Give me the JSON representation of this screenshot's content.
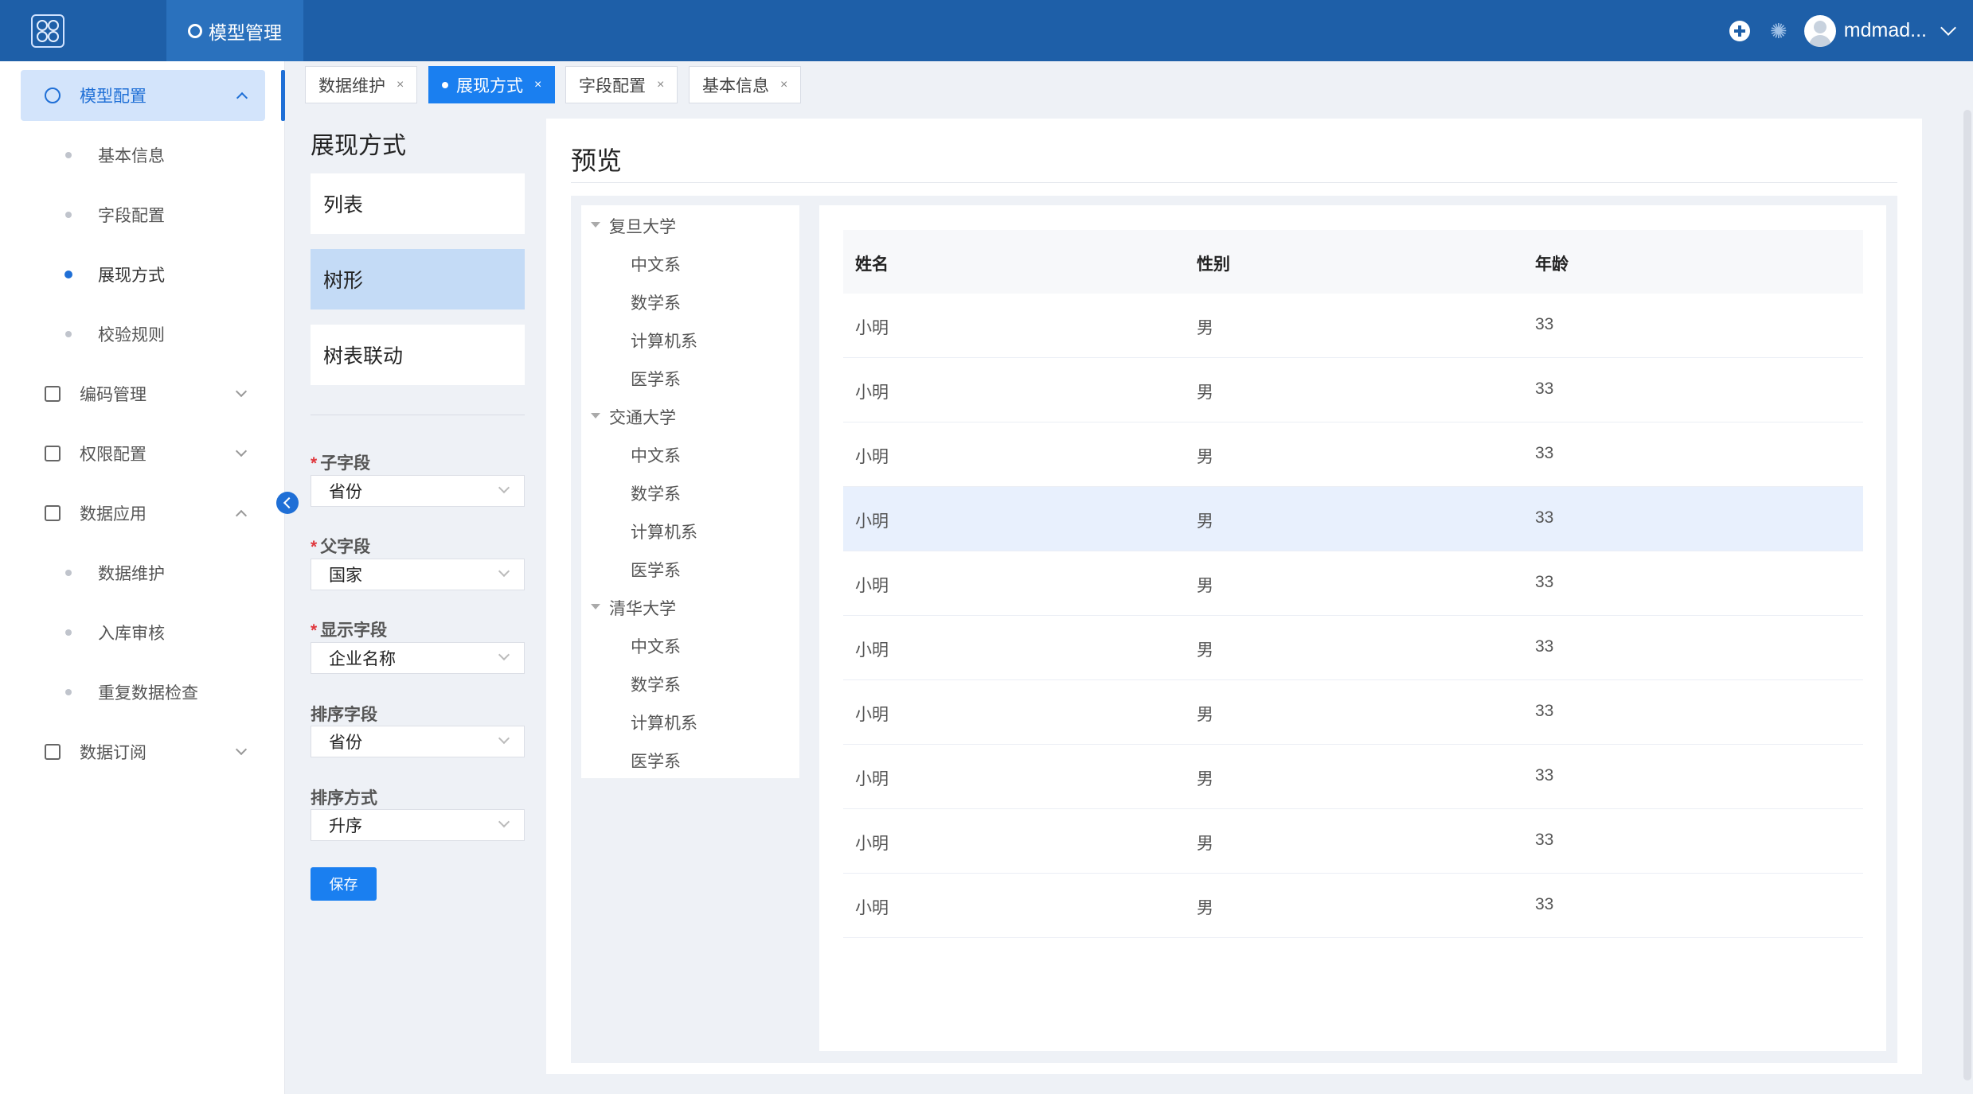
{
  "topbar": {
    "nav_item": "模型管理",
    "user_name": "mdmad...",
    "icons": [
      "logo-icon",
      "gear-icon",
      "plus-circle-icon",
      "ai-assistant-icon",
      "avatar",
      "chevron-down-icon"
    ]
  },
  "sidebar": {
    "model_config": "模型配置",
    "sub_basic_info": "基本信息",
    "sub_field_config": "字段配置",
    "sub_display_mode": "展现方式",
    "sub_validation_rules": "校验规则",
    "code_management": "编码管理",
    "permission_config": "权限配置",
    "data_application": "数据应用",
    "sub_data_maintenance": "数据维护",
    "sub_storage_review": "入库审核",
    "sub_duplicate_check": "重复数据检查",
    "data_subscription": "数据订阅"
  },
  "tabs": [
    {
      "label": "数据维护",
      "close": "×"
    },
    {
      "label": "展现方式",
      "close": "×"
    },
    {
      "label": "字段配置",
      "close": "×"
    },
    {
      "label": "基本信息",
      "close": "×"
    }
  ],
  "config": {
    "title": "展现方式",
    "modes": [
      "列表",
      "树形",
      "树表联动"
    ],
    "selected_mode": "树形",
    "fields": {
      "child_field": {
        "label": "子字段",
        "value": "省份"
      },
      "parent_field": {
        "label": "父字段",
        "value": "国家"
      },
      "display_field": {
        "label": "显示字段",
        "value": "企业名称"
      },
      "sort_field": {
        "label": "排序字段",
        "value": "省份"
      },
      "sort_order": {
        "label": "排序方式",
        "value": "升序"
      }
    },
    "required_mark": "*",
    "save_label": "保存"
  },
  "preview": {
    "title": "预览",
    "tree": [
      {
        "label": "复旦大学",
        "children": [
          "中文系",
          "数学系",
          "计算机系",
          "医学系"
        ]
      },
      {
        "label": "交通大学",
        "children": [
          "中文系",
          "数学系",
          "计算机系",
          "医学系"
        ]
      },
      {
        "label": "清华大学",
        "children": [
          "中文系",
          "数学系",
          "计算机系",
          "医学系"
        ]
      }
    ],
    "table": {
      "columns": [
        "姓名",
        "性别",
        "年龄"
      ],
      "rows": [
        [
          "小明",
          "男",
          "33"
        ],
        [
          "小明",
          "男",
          "33"
        ],
        [
          "小明",
          "男",
          "33"
        ],
        [
          "小明",
          "男",
          "33"
        ],
        [
          "小明",
          "男",
          "33"
        ],
        [
          "小明",
          "男",
          "33"
        ],
        [
          "小明",
          "男",
          "33"
        ],
        [
          "小明",
          "男",
          "33"
        ],
        [
          "小明",
          "男",
          "33"
        ],
        [
          "小明",
          "男",
          "33"
        ]
      ],
      "highlighted_row": 4
    }
  },
  "colors": {
    "header_bg": "#1e5fa8",
    "accent": "#1a7ff0",
    "selected_mode_bg": "#c4dbf6",
    "highlight_row_bg": "#e8f0fd",
    "required": "#e0383e"
  }
}
